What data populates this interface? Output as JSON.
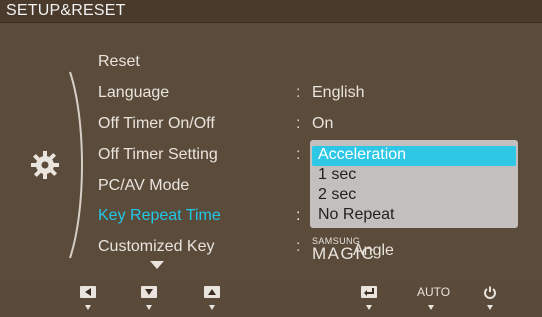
{
  "osd": {
    "title": "SETUP&RESET",
    "menu": [
      {
        "label": "Reset",
        "value": "",
        "has_colon": false
      },
      {
        "label": "Language",
        "value": "English",
        "has_colon": true
      },
      {
        "label": "Off Timer On/Off",
        "value": "On",
        "has_colon": true
      },
      {
        "label": "Off Timer Setting",
        "value": "",
        "has_colon": true
      },
      {
        "label": "PC/AV Mode",
        "value": "",
        "has_colon": false
      },
      {
        "label": "Key Repeat Time",
        "value": "",
        "has_colon": true
      },
      {
        "label": "Customized Key",
        "value": "",
        "has_colon": true
      }
    ],
    "customized_key_value": {
      "brand_small": "SAMSUNG",
      "brand_big": "MAGIC",
      "suffix": "Angle"
    },
    "dropdown": {
      "options": [
        "Acceleration",
        "1 sec",
        "2 sec",
        "No Repeat"
      ],
      "selected_index": 0
    },
    "colors": {
      "accent": "#20c8e8",
      "background": "#5b4b3b"
    },
    "bottom_buttons": [
      {
        "icon": "left-arrow-icon"
      },
      {
        "icon": "down-arrow-icon"
      },
      {
        "icon": "up-arrow-icon"
      },
      {
        "icon": "enter-icon"
      },
      {
        "label": "AUTO"
      },
      {
        "icon": "power-icon"
      }
    ]
  }
}
